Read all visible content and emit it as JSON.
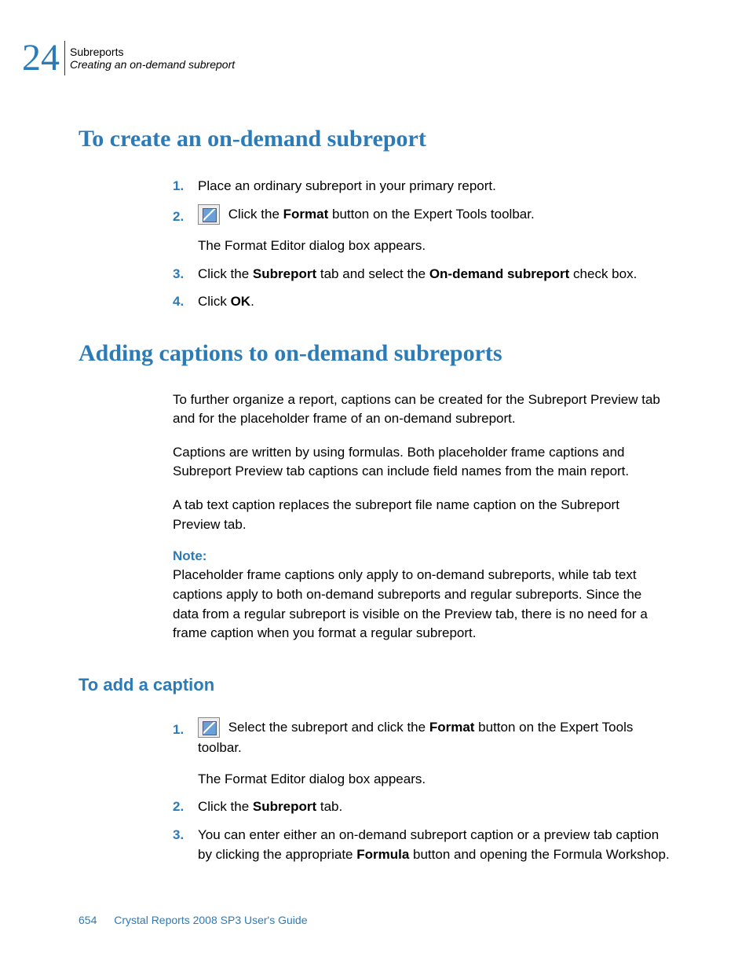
{
  "header": {
    "chapter_number": "24",
    "chapter_title": "Subreports",
    "section_title": "Creating an on-demand subreport"
  },
  "section1": {
    "heading": "To create an on-demand subreport",
    "steps": [
      {
        "num": "1.",
        "text": "Place an ordinary subreport in your primary report."
      },
      {
        "num": "2.",
        "has_icon": true,
        "text_before": " Click the ",
        "bold1": "Format",
        "text_after": " button on the Expert Tools toolbar.",
        "followup": "The Format Editor dialog box appears."
      },
      {
        "num": "3.",
        "text_before": "Click the ",
        "bold1": "Subreport",
        "text_mid": " tab and select the ",
        "bold2": "On-demand subreport",
        "text_after": " check box."
      },
      {
        "num": "4.",
        "text_before": "Click ",
        "bold1": "OK",
        "text_after": "."
      }
    ]
  },
  "section2": {
    "heading": "Adding captions to on-demand subreports",
    "paragraphs": [
      "To further organize a report, captions can be created for the Subreport Preview tab and for the placeholder frame of an on-demand subreport.",
      "Captions are written by using formulas. Both placeholder frame captions and Subreport Preview tab captions can include field names from the main report.",
      "A tab text caption replaces the subreport file name caption on the Subreport Preview tab."
    ],
    "note_label": "Note:",
    "note_text": "Placeholder frame captions only apply to on-demand subreports, while tab text captions apply to both on-demand subreports and regular subreports. Since the data from a regular subreport is visible on the Preview tab, there is no need for a frame caption when you format a regular subreport."
  },
  "section3": {
    "heading": "To add a caption",
    "steps": [
      {
        "num": "1.",
        "has_icon": true,
        "text_before": " Select the subreport and click the ",
        "bold1": "Format",
        "text_after": " button on the Expert Tools toolbar.",
        "followup": "The Format Editor dialog box appears."
      },
      {
        "num": "2.",
        "text_before": "Click the ",
        "bold1": "Subreport",
        "text_after": " tab."
      },
      {
        "num": "3.",
        "text_before": "You can enter either an on-demand subreport caption or a preview tab caption by clicking the appropriate ",
        "bold1": "Formula",
        "text_after": " button and opening the Formula Workshop."
      }
    ]
  },
  "footer": {
    "page_number": "654",
    "doc_title": "Crystal Reports 2008 SP3 User's Guide"
  }
}
